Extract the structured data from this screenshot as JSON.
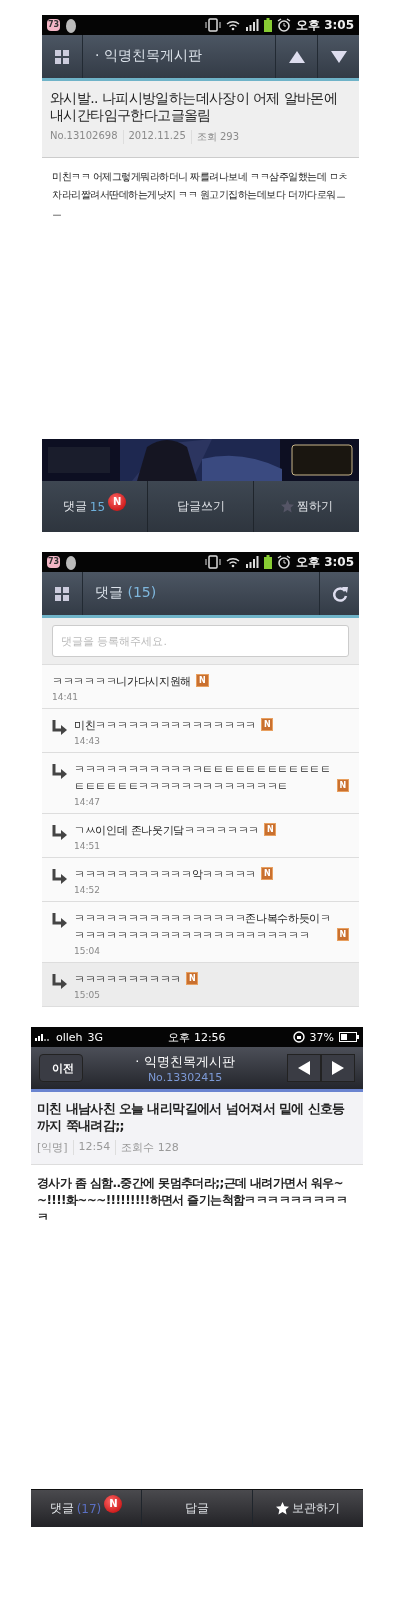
{
  "post_screen": {
    "status_bar": {
      "notification": "73",
      "time": "오후 3:05"
    },
    "header": {
      "title": "· 익명친목게시판"
    },
    "post": {
      "title": "와시발.. 나피시방일하는데사장이 어제 알바몬에 내시간타임구한다고글올림",
      "meta": [
        "No.13102698",
        "2012.11.25",
        "조회 293"
      ],
      "body": "미친ㅋㅋ 어제그렇게뭐라하더니 짜를려나보네 ㅋㅋ삼주일했는데 ㅁㅊ 차라리짤려서딴데하는게낫지 ㅋㅋ 원고기집하는데보다 더까다로워ㅡㅡ"
    },
    "bottom_bar": [
      {
        "kind": "comments",
        "label": "댓글",
        "count": "15",
        "badge": "N"
      },
      {
        "kind": "plain",
        "label": "답글쓰기"
      },
      {
        "kind": "star",
        "label": "찜하기"
      }
    ]
  },
  "comments_screen": {
    "status_bar": {
      "notification": "73",
      "time": "오후 3:05"
    },
    "header": {
      "title": "댓글",
      "count": "(15)"
    },
    "comment_field": {
      "placeholder": "댓글을 등록해주세요."
    },
    "comments": [
      {
        "text": "ㅋㅋㅋㅋㅋㅋ니가다시지원해",
        "badge": "N",
        "time": "14:41",
        "selected": false,
        "children": [
          {
            "text": "미친ㅋㅋㅋㅋㅋㅋㅋㅋㅋㅋㅋㅋㅋㅋㅋ",
            "badge": "N",
            "time": "14:43",
            "selected": false
          },
          {
            "text": "ㅋㅋㅋㅋㅋㅋㅋㅋㅋㅋㅋㅋㅌㅌㅌㅌㅌㅌㅌㅌㅌㅌㅌㅌㅌㅌㅌㅌㅌㅌㅋㅋㅋㅋㅋㅋㅋㅋㅋㅋㅋㅋㅋㅌ",
            "badge": "N",
            "time": "14:47",
            "selected": false
          },
          {
            "text": "ㄱㅆ이인데 존나웃기닼ㅋㅋㅋㅋㅋㅋㅋ",
            "badge": "N",
            "time": "14:51",
            "selected": false
          },
          {
            "text": "ㅋㅋㅋㅋㅋㅋㅋㅋㅋㅋㅋ악ㅋㅋㅋㅋㅋ",
            "badge": "N",
            "time": "14:52",
            "selected": false
          },
          {
            "text": "ㅋㅋㅋㅋㅋㅋㅋㅋㅋㅋㅋㅋㅋㅋㅋㅋ존나복수하듯이ㅋㅋㅋㅋㅋㅋㅋㅋㅋㅋㅋㅋㅋㅋㅋㅋㅋㅋㅋㅋㅋㅋㅋ",
            "badge": "N",
            "time": "15:04",
            "selected": false
          },
          {
            "text": "ㅋㅋㅋㅋㅋㅋㅋㅋㅋㅋ",
            "badge": "N",
            "time": "15:05",
            "selected": true
          }
        ]
      }
    ]
  },
  "ios_post_screen": {
    "status_bar": {
      "carrier": "olleh",
      "network": "3G",
      "time": "오후 12:56",
      "battery": "37%"
    },
    "nav": {
      "back": "이전",
      "title": "· 익명친목게시판",
      "number": "No.13302415"
    },
    "post": {
      "title": "미친 내남사친 오늘 내리막길에서 넘어져서 밑에 신호등까지 쭉내려감;;",
      "meta": [
        "[익명]",
        "12:54",
        "조회수 128"
      ],
      "body": "경사가 좀 심함..중간에 못멈추더라;;근데 내려가면서 워우~~!!!!화~~~!!!!!!!!!하면서 즐기는척함ㅋㅋㅋㅋㅋㅋㅋㅋㅋㅋ"
    },
    "bottom_bar": [
      {
        "kind": "comments",
        "label": "댓글",
        "count": "(17)",
        "badge": "N"
      },
      {
        "kind": "plain",
        "label": "답글"
      },
      {
        "kind": "star",
        "label": "보관하기"
      }
    ]
  }
}
